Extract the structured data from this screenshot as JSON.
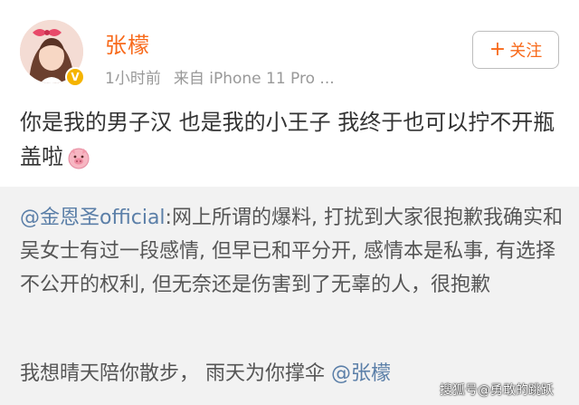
{
  "post": {
    "author_name": "张檬",
    "time": "1小时前",
    "source": "来自 iPhone 11 Pro ...",
    "follow_label": "关注",
    "text": "你是我的男子汉  也是我的小王子  我终于也可以拧不开瓶盖啦"
  },
  "repost": {
    "mention": "@金恩圣official",
    "text": ":网上所谓的爆料, 打扰到大家很抱歉我确实和吴女士有过一段感情, 但早已和平分开, 感情本是私事, 有选择不公开的权利, 但无奈还是伤害到了无辜的人，很抱歉",
    "line2_text": "我想晴天陪你散步，  雨天为你撑伞 ",
    "line2_mention": "@张檬"
  },
  "watermark": "搜狐号@勇敢的跳跃",
  "icons": [
    "verified-icon",
    "plus-icon",
    "pig-face-emoji"
  ],
  "colors": {
    "name": "#f86a1b",
    "mention": "#5b7fa8",
    "verified": "#f5b400",
    "repost_bg": "#f2f2f2",
    "meta": "#999999"
  }
}
